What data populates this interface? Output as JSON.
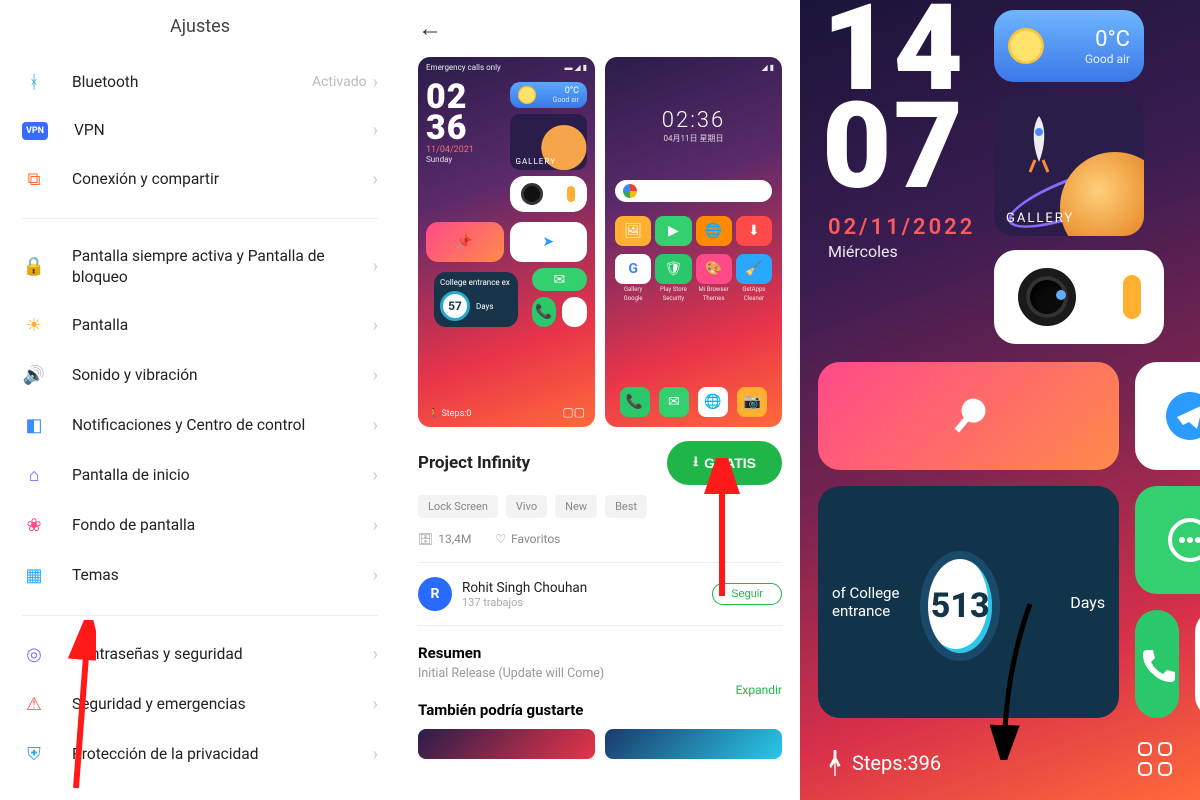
{
  "panel1": {
    "title": "Ajustes",
    "items": [
      {
        "icon": "bluetooth",
        "color": "#2aa8e8",
        "label": "Bluetooth",
        "value": "Activado"
      },
      {
        "icon": "vpn",
        "color": "#3a6bff",
        "label": "VPN"
      },
      {
        "icon": "share",
        "color": "#ff6a2a",
        "label": "Conexión y compartir"
      }
    ],
    "items2": [
      {
        "icon": "lock",
        "color": "#ff4a4a",
        "label": "Pantalla siempre activa y Pantalla de bloqueo"
      },
      {
        "icon": "sun",
        "color": "#ffb030",
        "label": "Pantalla"
      },
      {
        "icon": "sound",
        "color": "#2ac86a",
        "label": "Sonido y vibración"
      },
      {
        "icon": "notif",
        "color": "#3a8bff",
        "label": "Notificaciones y Centro de control"
      },
      {
        "icon": "home",
        "color": "#6a5aff",
        "label": "Pantalla de inicio"
      },
      {
        "icon": "wall",
        "color": "#ff4a8a",
        "label": "Fondo de pantalla"
      },
      {
        "icon": "theme",
        "color": "#2aa8ff",
        "label": "Temas"
      }
    ],
    "items3": [
      {
        "icon": "finger",
        "color": "#8a6aff",
        "label": "Contraseñas y seguridad"
      },
      {
        "icon": "alert",
        "color": "#ff4a4a",
        "label": "Seguridad y emergencias"
      },
      {
        "icon": "shield",
        "color": "#2aa8ff",
        "label": "Protección de la privacidad"
      }
    ]
  },
  "panel2": {
    "shot1": {
      "statusLeft": "Emergency calls only",
      "clock": "02\n36",
      "weatherTemp": "0°C",
      "weatherLabel": "Good air",
      "gallery": "GALLERY",
      "date": "11/04/2021",
      "day": "Sunday",
      "countdownTitle": "College entrance ex",
      "countdownNum": "57",
      "countdownUnit": "Days",
      "steps": "Steps:0"
    },
    "shot2": {
      "clock": "02:36",
      "date": "04月11日  星期日",
      "apps": [
        "Gallery",
        "Play Store",
        "Mi Browser",
        "GetApps",
        "Google",
        "Security",
        "Themes",
        "Cleaner"
      ]
    },
    "themeName": "Project Infinity",
    "freeLabel": "GRATIS",
    "tags": [
      "Lock Screen",
      "Vivo",
      "New",
      "Best"
    ],
    "size": "13,4M",
    "fav": "Favoritos",
    "authorInitial": "R",
    "authorName": "Rohit Singh Chouhan",
    "authorJobs": "137 trabajos",
    "follow": "Seguir",
    "summaryH": "Resumen",
    "summaryB": "Initial Release (Update will Come)",
    "expand": "Expandir",
    "alsoH": "También podría gustarte"
  },
  "panel3": {
    "clockTop": "14",
    "clockBot": "07",
    "weatherTemp": "0°C",
    "weatherLabel": "Good air",
    "gallery": "GALLERY",
    "date": "02/11/2022",
    "day": "Miércoles",
    "countdownTitle": "of College entrance",
    "countdownNum": "513",
    "countdownUnit": "Days",
    "stepsLabel": "Steps:",
    "stepsVal": "396"
  }
}
